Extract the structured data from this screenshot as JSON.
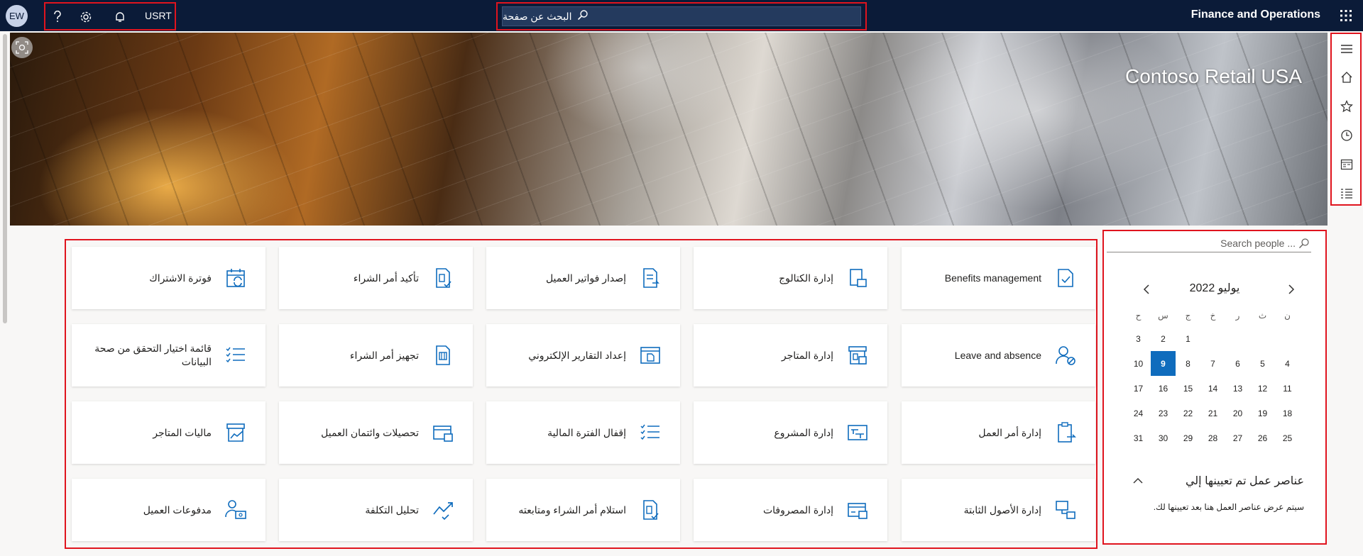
{
  "topbar": {
    "user_initials": "EW",
    "company_code": "USRT",
    "search_placeholder": "البحث عن صفحة",
    "app_title": "Finance and Operations"
  },
  "banner": {
    "company_name": "Contoso Retail USA"
  },
  "tiles": [
    {
      "label": "Benefits management",
      "icon": "benefits-icon"
    },
    {
      "label": "إدارة الكتالوج",
      "icon": "catalog-icon"
    },
    {
      "label": "إصدار فواتير العميل",
      "icon": "invoice-icon"
    },
    {
      "label": "تأكيد أمر الشراء",
      "icon": "po-confirm-icon"
    },
    {
      "label": "فوترة الاشتراك",
      "icon": "subscription-billing-icon"
    },
    {
      "label": "Leave and absence",
      "icon": "leave-icon"
    },
    {
      "label": "إدارة المتاجر",
      "icon": "store-management-icon"
    },
    {
      "label": "إعداد التقارير الإلكتروني",
      "icon": "electronic-reporting-icon"
    },
    {
      "label": "تجهيز أمر الشراء",
      "icon": "po-prep-icon"
    },
    {
      "label": "قائمة اختيار التحقق من صحة البيانات",
      "icon": "checklist-icon"
    },
    {
      "label": "إدارة أمر العمل",
      "icon": "work-order-icon"
    },
    {
      "label": "إدارة المشروع",
      "icon": "project-icon"
    },
    {
      "label": "إقفال الفترة المالية",
      "icon": "period-close-icon"
    },
    {
      "label": "تحصيلات وائتمان العميل",
      "icon": "credit-collections-icon"
    },
    {
      "label": "ماليات المتاجر",
      "icon": "store-financials-icon"
    },
    {
      "label": "إدارة الأصول الثابتة",
      "icon": "fixed-assets-icon"
    },
    {
      "label": "إدارة المصروفات",
      "icon": "expense-icon"
    },
    {
      "label": "استلام أمر الشراء ومتابعته",
      "icon": "po-receipt-icon"
    },
    {
      "label": "تحليل التكلفة",
      "icon": "cost-analysis-icon"
    },
    {
      "label": "مدفوعات العميل",
      "icon": "customer-payments-icon"
    }
  ],
  "people_search": {
    "placeholder": "Search people ..."
  },
  "calendar": {
    "month_label": "يوليو 2022",
    "weekdays": [
      "ن",
      "ث",
      "ر",
      "خ",
      "ج",
      "س",
      "ح"
    ],
    "weeks": [
      [
        "",
        "",
        "",
        "",
        "1",
        "2",
        "3"
      ],
      [
        "4",
        "5",
        "6",
        "7",
        "8",
        "9",
        "10"
      ],
      [
        "11",
        "12",
        "13",
        "14",
        "15",
        "16",
        "17"
      ],
      [
        "18",
        "19",
        "20",
        "21",
        "22",
        "23",
        "24"
      ],
      [
        "25",
        "26",
        "27",
        "28",
        "29",
        "30",
        "31"
      ]
    ],
    "selected_day": "9"
  },
  "work_items": {
    "title": "عناصر عمل تم تعيينها إلي",
    "empty_message": "سيتم عرض عناصر العمل هنا بعد تعيينها لك."
  },
  "colors": {
    "topbar_bg": "#0b1b38",
    "accent": "#0f6cbd",
    "highlight": "#e0141e"
  }
}
